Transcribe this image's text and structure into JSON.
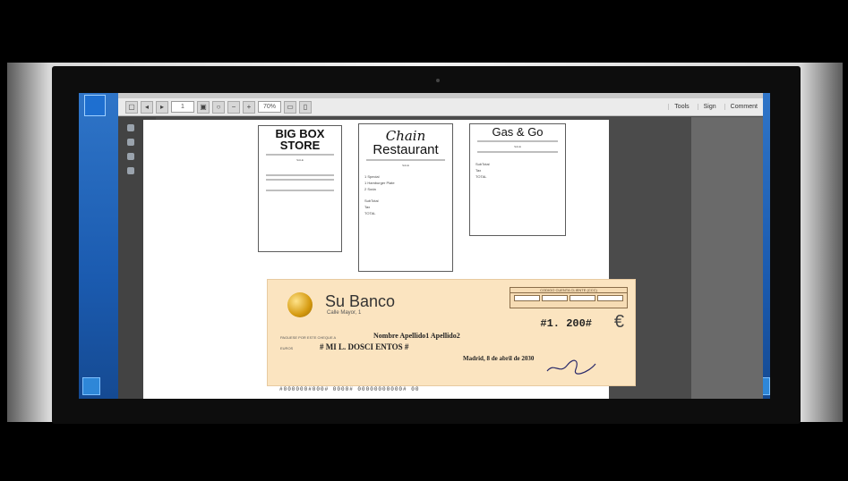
{
  "toolbar": {
    "zoom_value": "70%",
    "page_value": "1",
    "tools_label": "Tools",
    "sign_label": "Sign",
    "comment_label": "Comment"
  },
  "receipts": {
    "big_box": {
      "title_line1": "BIG BOX",
      "title_line2": "STORE",
      "sale": "SALE"
    },
    "chain": {
      "title_line1": "Chain",
      "title_line2": "Restaurant",
      "sale": "SALE",
      "item1": "1 Special",
      "item2": "1 Hamburger Plate",
      "item3": "2 Soda",
      "subtotal": "SubTotal",
      "tax": "Tax",
      "total": "TOTAL"
    },
    "gas_go": {
      "title": "Gas & Go",
      "sale": "SALE",
      "subtotal": "SubTotal",
      "tax": "Tax",
      "total": "TOTAL"
    }
  },
  "cheque": {
    "bank_name": "Su Banco",
    "bank_address": "Calle Mayor, 1",
    "account_header": "CODIGO CUENTA CLIENTE (CCC)",
    "amount": "#1. 200#",
    "currency_symbol": "€",
    "payee_label": "PAGUESE POR ESTE CHEQUE A",
    "payee": "Nombre Apellido1 Apellido2",
    "words_label": "EUROS",
    "amount_words": "# MI L. DOSCI ENTOS #",
    "place_date": "Madrid, 8  de  abril  de  2030",
    "micr": "#000000#000#  0000#  00000000000#  00"
  },
  "colors": {
    "desktop_blue": "#1b5bb0",
    "cheque_bg": "#fbe4c0",
    "coin_gold": "#d59a10"
  }
}
